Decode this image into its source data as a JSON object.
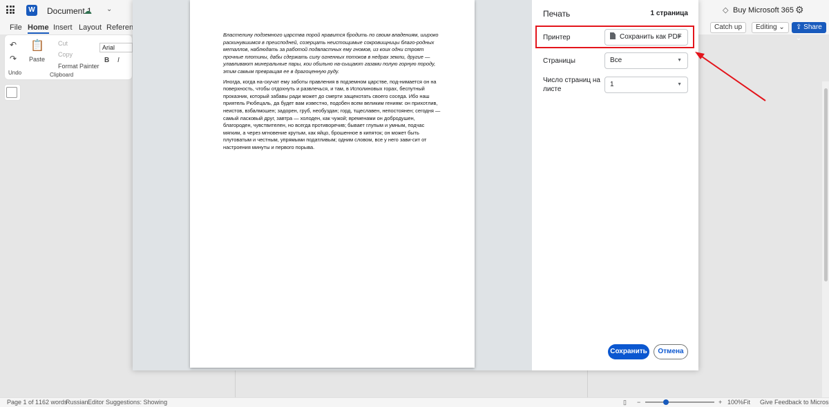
{
  "titlebar": {
    "doc_title": "Document 1",
    "buy_label": "Buy Microsoft 365"
  },
  "menu": {
    "file": "File",
    "home": "Home",
    "insert": "Insert",
    "layout": "Layout",
    "references": "Reference"
  },
  "toolbar_right": {
    "catch_up": "Catch up",
    "editing": "Editing",
    "share": "Share"
  },
  "ribbon": {
    "undo": "Undo",
    "paste": "Paste",
    "cut": "Cut",
    "copy": "Copy",
    "format_painter": "Format Painter",
    "clipboard": "Clipboard",
    "font": "Arial",
    "bold": "B",
    "italic": "I"
  },
  "status": {
    "page": "Page 1 of 1",
    "words": "162 words",
    "language": "Russian",
    "editor": "Editor Suggestions: Showing",
    "zoom": "100%",
    "fit": "Fit",
    "feedback": "Give Feedback to Microsoft"
  },
  "print": {
    "title": "Печать",
    "page_count": "1 страница",
    "printer_label": "Принтер",
    "printer_value": "Сохранить как PDF",
    "pages_label": "Страницы",
    "pages_value": "Все",
    "per_sheet_label_1": "Число страниц на",
    "per_sheet_label_2": "листе",
    "per_sheet_value": "1",
    "save_button": "Сохранить",
    "cancel_button": "Отмена"
  },
  "preview": {
    "paragraph1": "Властелину подземного царства порой нравится бродить по своим владениям, широко раскинувшимся в преисподней, созерцать неистощимые сокровищницы благо-родных металлов, наблюдать за работой подвластных ему гномов, из коих одни строят прочные плотины, дабы сдержать силу огненных потоков в недрах земли, другие — улавливают минеральные пары, кои обильно на-сыщают газами полую горную породу, этим самым превращая ее в драгоценную руду.",
    "paragraph2": "Иногда, когда на-скучат ему заботы правления в подземном царстве, под-нимается он на поверхность, чтобы отдохнуть и развлечься, и там, в Исполиновых горах, беспутный проказник, который забавы ради может до смерти защекотать своего соседа. Ибо наш приятель Рюбецаль, да будет вам известно, подобен всем великим гениям: он прихотлив, неистов, взбалмошен; задорен, груб, необуздан; горд, тщеславен, непостоянен; сегодня — самый ласковый друг, завтра — холоден, как чужой; временами он добродушен, благороден, чувствителен, но всегда противоречив; бывает глупым и умным, подчас мягким, а через мгновение крутым, как яйцо, брошенное в кипяток; он может быть плутоватым и честным, упрямыми податливым; одним словом, все у него зави-сит от настроения минуты и первого порыва."
  },
  "colors": {
    "highlight": "#e3141b",
    "primary": "#0b57d0",
    "word_blue": "#185abd"
  }
}
